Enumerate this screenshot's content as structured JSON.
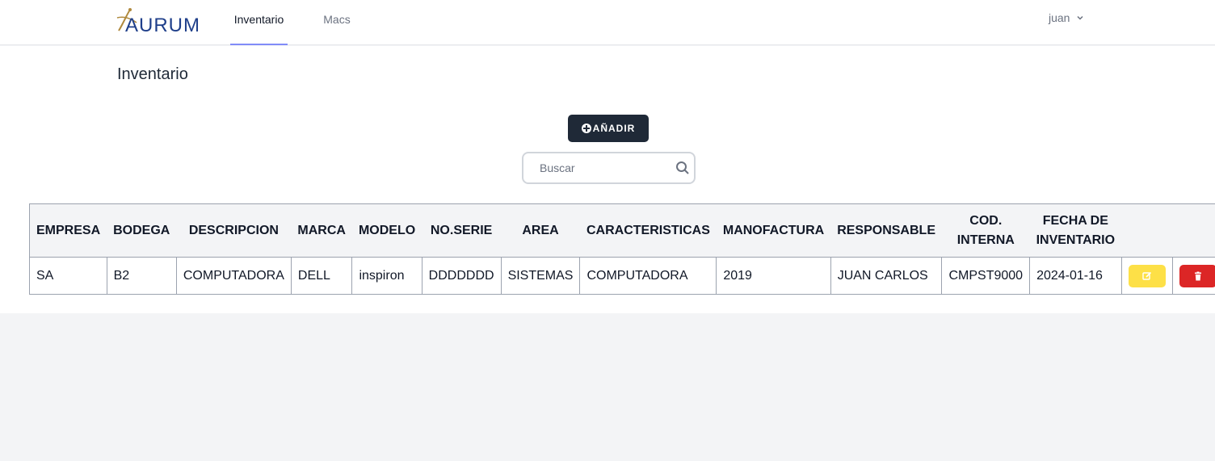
{
  "nav": {
    "logo_text": "AURUM",
    "links": [
      "Inventario",
      "Macs"
    ],
    "user_name": "juan"
  },
  "page": {
    "title": "Inventario",
    "add_button_label": "AÑADIR",
    "search_placeholder": "Buscar"
  },
  "table": {
    "headers": [
      "EMPRESA",
      "BODEGA",
      "DESCRIPCION",
      "MARCA",
      "MODELO",
      "NO.SERIE",
      "AREA",
      "CARACTERISTICAS",
      "MANOFACTURA",
      "RESPONSABLE",
      "COD. INTERNA",
      "FECHA DE INVENTARIO"
    ],
    "rows": [
      [
        "SA",
        "B2",
        "COMPUTADORA",
        "DELL",
        "inspiron",
        "DDDDDDD",
        "SISTEMAS",
        "COMPUTADORA",
        "2019",
        "JUAN CARLOS",
        "CMPST9000",
        "2024-01-16"
      ]
    ]
  },
  "colors": {
    "accent": "#818cf8",
    "dark_button": "#1f2937",
    "edit_button": "#fde047",
    "delete_button": "#dc2626"
  },
  "icons": {
    "logo": "aurum-logo-icon",
    "add": "plus-circle-icon",
    "search": "search-icon",
    "user_menu": "chevron-down-icon",
    "edit": "edit-icon",
    "delete": "trash-icon"
  }
}
